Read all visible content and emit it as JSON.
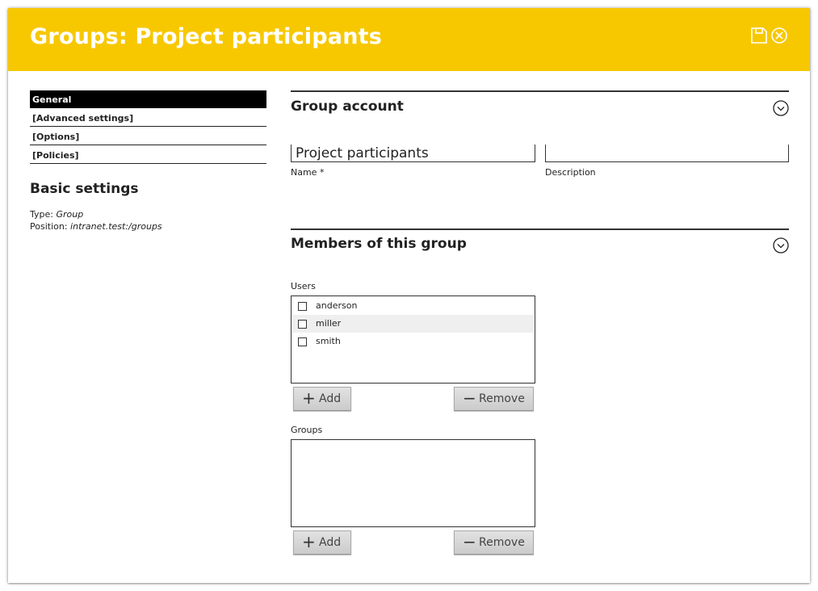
{
  "dialog": {
    "title": "Groups: Project participants",
    "save_icon": "save-icon",
    "close_icon": "close-icon"
  },
  "sidebar": {
    "tabs": [
      {
        "label": "General",
        "active": true
      },
      {
        "label": "[Advanced settings]",
        "active": false
      },
      {
        "label": "[Options]",
        "active": false
      },
      {
        "label": "[Policies]",
        "active": false
      }
    ],
    "heading": "Basic settings",
    "type_label": "Type:",
    "type_value": "Group",
    "position_label": "Position:",
    "position_value": "intranet.test:/groups"
  },
  "group_account": {
    "title": "Group account",
    "name_value": "Project participants",
    "name_label": "Name *",
    "description_value": "",
    "description_label": "Description"
  },
  "members": {
    "title": "Members of this group",
    "users_label": "Users",
    "users": [
      {
        "name": "anderson",
        "checked": false
      },
      {
        "name": "miller",
        "checked": false
      },
      {
        "name": "smith",
        "checked": false
      }
    ],
    "groups_label": "Groups",
    "groups": [],
    "add_label": "Add",
    "remove_label": "Remove"
  },
  "colors": {
    "accent": "#f7c800",
    "button": "#d6d6d6"
  }
}
